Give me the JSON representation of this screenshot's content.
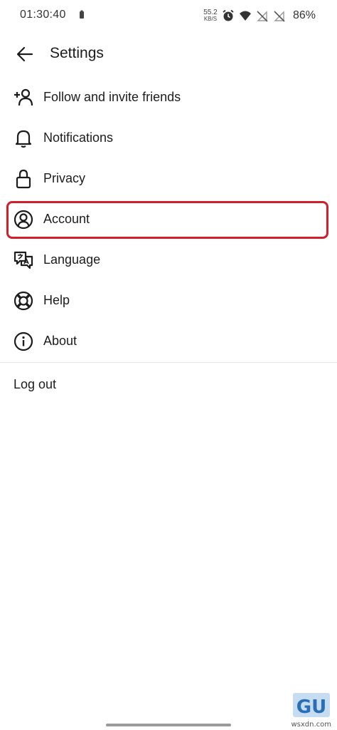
{
  "status_bar": {
    "time": "01:30:40",
    "net_speed_value": "55.2",
    "net_speed_unit": "KB/S",
    "battery": "86%"
  },
  "header": {
    "title": "Settings"
  },
  "menu": {
    "items": [
      {
        "label": "Follow and invite friends",
        "icon": "add-person-icon"
      },
      {
        "label": "Notifications",
        "icon": "bell-icon"
      },
      {
        "label": "Privacy",
        "icon": "lock-icon"
      },
      {
        "label": "Account",
        "icon": "account-circle-icon"
      },
      {
        "label": "Language",
        "icon": "translate-icon"
      },
      {
        "label": "Help",
        "icon": "lifebuoy-icon"
      },
      {
        "label": "About",
        "icon": "info-icon"
      }
    ]
  },
  "logout_label": "Log out",
  "highlight_color": "#d0202b",
  "watermark": {
    "logo_text": "GU",
    "site": "wsxdn.com"
  }
}
